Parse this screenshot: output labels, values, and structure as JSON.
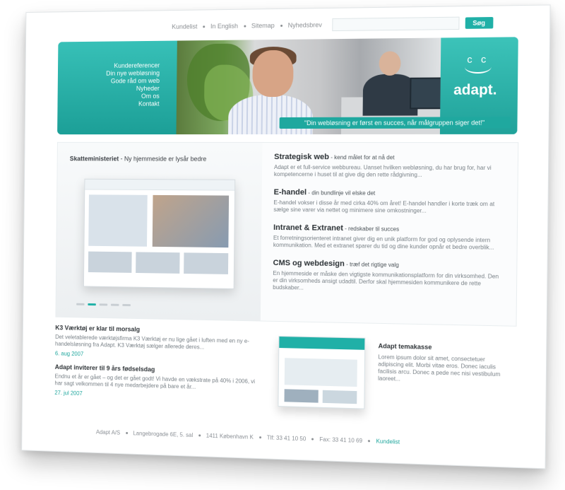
{
  "topbar": {
    "links": [
      "Kundelist",
      "In English",
      "Sitemap",
      "Nyhedsbrev"
    ],
    "search_placeholder": "",
    "search_button": "Søg"
  },
  "hero": {
    "nav": [
      "Kundereferencer",
      "Din nye webløsning",
      "Gode råd om web",
      "Nyheder",
      "Om os",
      "Kontakt"
    ],
    "logo_text": "adapt.",
    "tagline": "\"Din webløsning er først en succes, når målgruppen siger det!\""
  },
  "showcase": {
    "caption_bold": "Skatteministeriet",
    "caption_rest": " - Ny hjemmeside er lysår bedre"
  },
  "services": [
    {
      "title": "Strategisk web",
      "subtitle": " - kend målet for at nå det",
      "text": "Adapt er et full-service webbureau. Uanset hvilken webløsning, du har brug for, har vi kompetencerne i huset til at give dig den rette rådgivning..."
    },
    {
      "title": "E-handel",
      "subtitle": " - din bundlinje vil elske det",
      "text": "E-handel vokser i disse år med cirka 40% om året! E-handel handler i korte træk om at sælge sine varer via nettet og minimere sine omkostninger..."
    },
    {
      "title": "Intranet & Extranet",
      "subtitle": " - redskaber til succes",
      "text": "Et forretningsorienteret intranet giver dig en unik platform for god og oplysende intern kommunikation. Med et extranet sparer du tid og dine kunder opnår et bedre overblik..."
    },
    {
      "title": "CMS og webdesign",
      "subtitle": " - træf det rigtige valg",
      "text": "En hjemmeside er måske den vigtigste kommunikationsplatform for din virksomhed. Den er din virksomheds ansigt udadtil. Derfor skal hjemmesiden kommunikere de rette budskaber..."
    }
  ],
  "news": [
    {
      "title": "K3 Værktøj er klar til morsalg",
      "text": "Det veletablerede værktøjsfirma K3 Værktøj er nu lige gået i luften med en ny e-handelsløsning fra Adapt. K3 Værktøj sælger allerede deres...",
      "date": "6. aug 2007"
    },
    {
      "title": "Adapt inviterer til 9 års fødselsdag",
      "text": "Endnu et år er gået – og det er gået godt! Vi havde en vækstrate på 40% i 2006, vi har sagt velkommen til 4 nye medarbejdere på bare et år...",
      "date": "27. jul 2007"
    }
  ],
  "feature": {
    "title": "Adapt temakasse",
    "text": "Lorem ipsum dolor sit amet, consectetuer adipiscing elit. Morbi vitae eros. Donec iaculis facilisis arcu. Donec a pede nec nisi vestibulum laoreet..."
  },
  "footer": {
    "parts": [
      "Adapt A/S",
      "Langebrogade 6E, 5. sal",
      "1411 København K",
      "Tlf: 33 41 10 50",
      "Fax: 33 41 10 69"
    ],
    "link": "Kundelist"
  },
  "colors": {
    "brand_teal": "#20b0a7",
    "text_dark": "#2b3135",
    "text_muted": "#7a8288"
  }
}
